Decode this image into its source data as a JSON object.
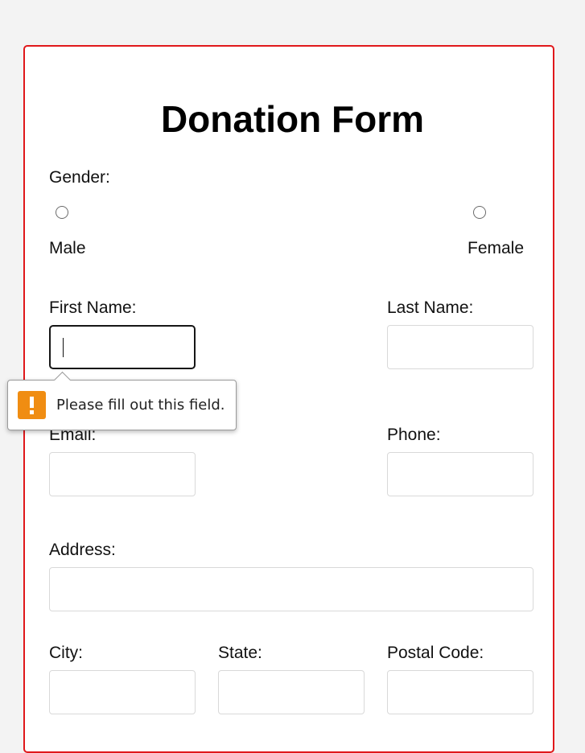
{
  "form": {
    "title": "Donation Form",
    "gender": {
      "label": "Gender:",
      "options": [
        "Male",
        "Female"
      ]
    },
    "first_name": {
      "label": "First Name:",
      "value": ""
    },
    "last_name": {
      "label": "Last Name:",
      "value": ""
    },
    "email": {
      "label": "Email:",
      "value": ""
    },
    "phone": {
      "label": "Phone:",
      "value": ""
    },
    "address": {
      "label": "Address:",
      "value": ""
    },
    "city": {
      "label": "City:",
      "value": ""
    },
    "state": {
      "label": "State:",
      "value": ""
    },
    "postal_code": {
      "label": "Postal Code:",
      "value": ""
    }
  },
  "validation": {
    "message": "Please fill out this field.",
    "icon": "warning-icon"
  },
  "colors": {
    "card_border": "#e0181b",
    "warning": "#f08d12",
    "page_background": "#f3f3f3"
  }
}
